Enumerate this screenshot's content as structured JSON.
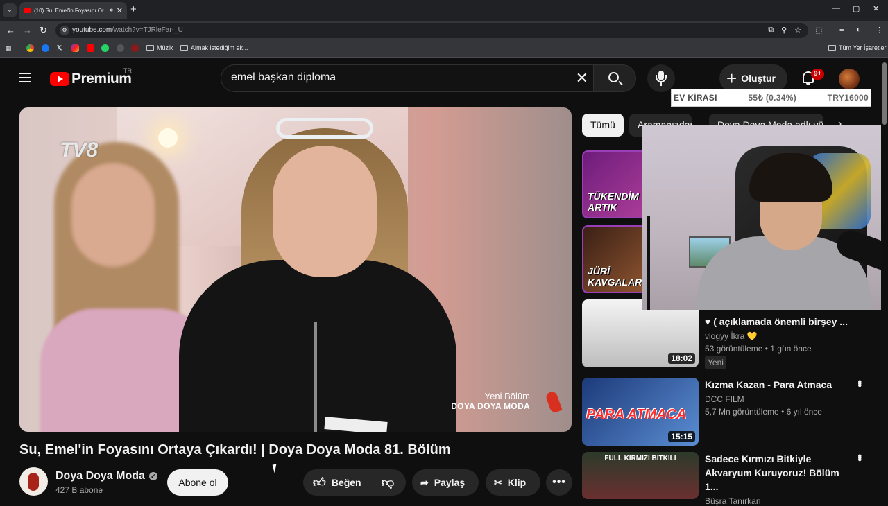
{
  "browser": {
    "tab": {
      "title": "(10) Su, Emel'in Foyasını Or...",
      "favicon": "youtube-icon",
      "audio": "speaker-icon",
      "close": "✕"
    },
    "new_tab": "+",
    "window_controls": {
      "minimize": "—",
      "maximize": "▢",
      "close": "✕"
    },
    "url_host": "youtube.com",
    "url_path": "/watch?v=TJRleFar-_U",
    "bookmarks": [
      {
        "label": "",
        "icon": "chrome-icon"
      },
      {
        "label": "",
        "icon": "facebook-icon"
      },
      {
        "label": "",
        "icon": "x-icon"
      },
      {
        "label": "",
        "icon": "instagram-icon"
      },
      {
        "label": "",
        "icon": "youtube-icon"
      },
      {
        "label": "",
        "icon": "whatsapp-icon"
      },
      {
        "label": "",
        "icon": "threads-icon"
      },
      {
        "label": "",
        "icon": "pinterest-icon"
      },
      {
        "label": "Müzik",
        "icon": "folder-icon"
      },
      {
        "label": "Almak istediğim ek...",
        "icon": "folder-icon"
      }
    ],
    "all_bookmarks": "Tüm Yer İşaretleri"
  },
  "youtube": {
    "logo_text": "Premium",
    "region": "TR",
    "search_value": "emel başkan diploma",
    "create_label": "Oluştur",
    "notifications": "9+"
  },
  "ticker": {
    "name": "EV KİRASI",
    "change": "55₺ (0.34%)",
    "value": "TRY16000"
  },
  "video": {
    "channel_logo": "TV8",
    "overlay_line1": "Yeni Bölüm",
    "overlay_line2": "DOYA DOYA MODA",
    "title": "Su, Emel'in Foyasını Ortaya Çıkardı! | Doya Doya Moda 81. Bölüm",
    "channel": "Doya Doya Moda",
    "subscribers": "427 B abone",
    "subscribe": "Abone ol",
    "like": "Beğen",
    "share": "Paylaş",
    "clip": "Klip"
  },
  "chips": [
    "Tümü",
    "Aramanızdan",
    "Doya Doya Moda adlı yü..."
  ],
  "recommendations": [
    {
      "thumb_caption": "TÜKENDİM ARTIK"
    },
    {
      "thumb_caption": "JÜRİ KAVGALARI"
    },
    {
      "title": "♥ ( açıklamada önemli birşey ...",
      "channel": "vlogyy İkra 💛",
      "stats": "53 görüntüleme • 1 gün önce",
      "badge": "Yeni",
      "duration": "18:02"
    },
    {
      "title": "Kızma Kazan - Para Atmaca",
      "channel": "DCC FILM",
      "stats": "5,7 Mn görüntüleme • 6 yıl önce",
      "duration": "15:15",
      "thumb_caption": "PARA ATMACA"
    },
    {
      "title": "Sadece Kırmızı Bitkiyle Akvaryum Kuruyoruz! Bölüm 1...",
      "channel": "Büşra Tanırkan",
      "thumb_caption": "FULL KIRMIZI BITKILI"
    }
  ]
}
